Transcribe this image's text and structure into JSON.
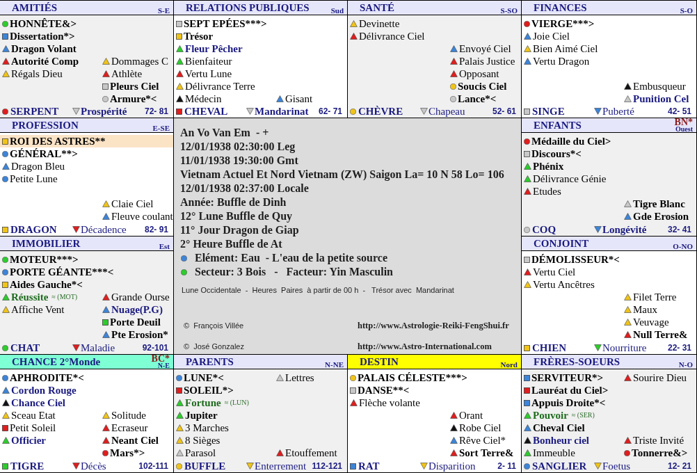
{
  "palaces": [
    {
      "header": {
        "title": "AMITIÉS",
        "direction": "S-E",
        "color": "#e6e6fa"
      },
      "shaded": true,
      "main_stars": [
        {
          "kind": "circle",
          "color": "#2ecc2e",
          "label": {
            "text": "HONNÊTE&>",
            "color": "#000000",
            "bold": true
          },
          "highlighted": false
        },
        {
          "kind": "square",
          "color": "#3d85d8",
          "label": {
            "text": "Dissertation*>",
            "color": "#000000",
            "bold": true
          },
          "highlighted": false
        },
        {
          "kind": "triangle",
          "color": "#3d85d8",
          "label": {
            "text": "Dragon Volant",
            "color": "#000000",
            "bold": true
          },
          "highlighted": false
        },
        {
          "kind": "triangle",
          "color": "#e01e1e",
          "label": {
            "text": "Autorité Comp",
            "color": "#000000",
            "bold": true
          },
          "highlighted": false
        },
        {
          "kind": "triangle",
          "color": "#f0c419",
          "label": {
            "text": "Régals Dieu",
            "color": "#000000",
            "bold": false
          },
          "highlighted": false
        }
      ],
      "side_stars_bottom": [
        {
          "kind": "triangle",
          "color": "#f0c419",
          "label": {
            "text": "Dommages C",
            "color": "#000000",
            "bold": false
          }
        },
        {
          "kind": "triangle",
          "color": "#e01e1e",
          "label": {
            "text": "Athlète",
            "color": "#000000",
            "bold": false
          }
        },
        {
          "kind": "square",
          "color": "#c8c8c8",
          "label": {
            "text": "Pleurs Ciel",
            "color": "#000000",
            "bold": true
          }
        },
        {
          "kind": "circle",
          "color": "#c8c8c8",
          "label": {
            "text": "Armure*<",
            "color": "#000000",
            "bold": true
          }
        }
      ],
      "footer": {
        "branch": {
          "name": "SERPENT",
          "kind": "circle",
          "color": "#e01e1e"
        },
        "phase": {
          "name": "Prospérité",
          "color": "#c8c8c8",
          "bold": true
        },
        "ages": "72- 81"
      }
    },
    {
      "header": {
        "title": "RELATIONS PUBLIQUES",
        "direction": "Sud",
        "color": "#e6e6fa"
      },
      "shaded": false,
      "main_stars": [
        {
          "kind": "square",
          "color": "#c8c8c8",
          "label": {
            "text": "SEPT EPÉES***>",
            "color": "#000000",
            "bold": true
          },
          "highlighted": false
        },
        {
          "kind": "square",
          "color": "#f0c419",
          "label": {
            "text": "Trésor",
            "color": "#000000",
            "bold": true
          },
          "highlighted": false
        },
        {
          "kind": "triangle",
          "color": "#2ecc2e",
          "label": {
            "text": "Fleur Pêcher",
            "color": "#1a1a80",
            "bold": true
          },
          "highlighted": false
        },
        {
          "kind": "triangle",
          "color": "#2ecc2e",
          "label": {
            "text": "Bienfaiteur",
            "color": "#000000",
            "bold": false
          },
          "highlighted": false
        },
        {
          "kind": "triangle",
          "color": "#e01e1e",
          "label": {
            "text": "Vertu Lune",
            "color": "#000000",
            "bold": false
          },
          "highlighted": false
        },
        {
          "kind": "triangle",
          "color": "#f0c419",
          "label": {
            "text": "Délivrance Terre",
            "color": "#000000",
            "bold": false
          },
          "highlighted": false
        },
        {
          "kind": "triangle",
          "color": "#111111",
          "label": {
            "text": "Médecin",
            "color": "#000000",
            "bold": false
          },
          "highlighted": false
        }
      ],
      "side_stars_bottom": [
        {
          "kind": "triangle",
          "color": "#3d85d8",
          "label": {
            "text": "Gisant",
            "color": "#000000",
            "bold": false
          }
        }
      ],
      "footer": {
        "branch": {
          "name": "CHEVAL",
          "kind": "square",
          "color": "#e01e1e"
        },
        "phase": {
          "name": "Mandarinat",
          "color": "#c8c8c8",
          "bold": true
        },
        "ages": "62- 71"
      }
    },
    {
      "header": {
        "title": "SANTÉ",
        "direction": "S-SO",
        "color": "#e6e6fa"
      },
      "shaded": true,
      "main_stars": [
        {
          "kind": "triangle",
          "color": "#f0c419",
          "label": {
            "text": "Devinette",
            "color": "#000000",
            "bold": false
          },
          "highlighted": false
        },
        {
          "kind": "triangle",
          "color": "#e01e1e",
          "label": {
            "text": "Délivrance Ciel",
            "color": "#000000",
            "bold": false
          },
          "highlighted": false
        }
      ],
      "side_stars_bottom": [
        {
          "kind": "triangle",
          "color": "#3d85d8",
          "label": {
            "text": "Envoyé Ciel",
            "color": "#000000",
            "bold": false
          }
        },
        {
          "kind": "triangle",
          "color": "#e01e1e",
          "label": {
            "text": "Palais Justice",
            "color": "#000000",
            "bold": false
          }
        },
        {
          "kind": "triangle",
          "color": "#e01e1e",
          "label": {
            "text": "Opposant",
            "color": "#000000",
            "bold": false
          }
        },
        {
          "kind": "circle",
          "color": "#f0c419",
          "label": {
            "text": "Soucis Ciel",
            "color": "#000000",
            "bold": true
          }
        },
        {
          "kind": "circle",
          "color": "#c8c8c8",
          "label": {
            "text": "Lance*<",
            "color": "#000000",
            "bold": true
          }
        }
      ],
      "footer": {
        "branch": {
          "name": "CHÈVRE",
          "kind": "circle",
          "color": "#f0c419"
        },
        "phase": {
          "name": "Chapeau",
          "color": "#c8c8c8",
          "bold": false
        },
        "ages": "52- 61"
      }
    },
    {
      "header": {
        "title": "FINANCES",
        "direction": "S-O",
        "color": "#e6e6fa"
      },
      "shaded": false,
      "main_stars": [
        {
          "kind": "circle",
          "color": "#e01e1e",
          "label": {
            "text": "VIERGE***>",
            "color": "#000000",
            "bold": true
          },
          "highlighted": false
        },
        {
          "kind": "triangle",
          "color": "#3d85d8",
          "label": {
            "text": "Joie Ciel",
            "color": "#000000",
            "bold": false
          },
          "highlighted": false
        },
        {
          "kind": "triangle",
          "color": "#f0c419",
          "label": {
            "text": "Bien Aimé Ciel",
            "color": "#000000",
            "bold": false
          },
          "highlighted": false
        },
        {
          "kind": "triangle",
          "color": "#3d85d8",
          "label": {
            "text": "Vertu Dragon",
            "color": "#000000",
            "bold": false
          },
          "highlighted": false
        }
      ],
      "side_stars_bottom": [
        {
          "kind": "triangle",
          "color": "#111111",
          "label": {
            "text": "Embusqueur",
            "color": "#000000",
            "bold": false
          }
        },
        {
          "kind": "triangle",
          "color": "#c8c8c8",
          "label": {
            "text": "Punition Cel",
            "color": "#1a1a80",
            "bold": true
          }
        }
      ],
      "footer": {
        "branch": {
          "name": "SINGE",
          "kind": "square",
          "color": "#c8c8c8"
        },
        "phase": {
          "name": "Puberté",
          "color": "#3d85d8",
          "bold": false
        },
        "ages": "42- 51"
      }
    },
    {
      "header": {
        "title": "PROFESSION",
        "direction": "E-SE",
        "color": "#e6e6fa"
      },
      "shaded": false,
      "main_stars": [
        {
          "kind": "square",
          "color": "#f0c419",
          "label": {
            "text": "ROI DES ASTRES**",
            "color": "#000000",
            "bold": true
          },
          "highlighted": true
        },
        {
          "kind": "circle",
          "color": "#3d85d8",
          "label": {
            "text": "GÉNÉRAL**>",
            "color": "#000000",
            "bold": true
          },
          "highlighted": false
        },
        {
          "kind": "triangle",
          "color": "#3d85d8",
          "label": {
            "text": "Dragon Bleu",
            "color": "#000000",
            "bold": false
          },
          "highlighted": false
        },
        {
          "kind": "circle",
          "color": "#3d85d8",
          "label": {
            "text": "Petite Lune",
            "color": "#000000",
            "bold": false
          },
          "highlighted": false
        }
      ],
      "side_stars_bottom": [
        {
          "kind": "triangle",
          "color": "#f0c419",
          "label": {
            "text": "Claie Ciel",
            "color": "#000000",
            "bold": false
          }
        },
        {
          "kind": "triangle",
          "color": "#3d85d8",
          "label": {
            "text": "Fleuve coulant",
            "color": "#000000",
            "bold": false
          }
        }
      ],
      "footer": {
        "branch": {
          "name": "DRAGON",
          "kind": "square",
          "color": "#f0c419"
        },
        "phase": {
          "name": "Décadence",
          "color": "#e01e1e",
          "bold": false
        },
        "ages": "82- 91"
      }
    },
    {
      "header": {
        "title": "ENFANTS",
        "direction": "Ouest",
        "marker": "BN*",
        "color": "#e6e6fa"
      },
      "shaded": true,
      "main_stars": [
        {
          "kind": "circle",
          "color": "#e01e1e",
          "label": {
            "text": "Médaille du Ciel>",
            "color": "#000000",
            "bold": true
          },
          "highlighted": false
        },
        {
          "kind": "square",
          "color": "#c8c8c8",
          "label": {
            "text": "Discours*<",
            "color": "#000000",
            "bold": true
          },
          "highlighted": false
        },
        {
          "kind": "triangle",
          "color": "#2ecc2e",
          "label": {
            "text": "Phénix",
            "color": "#000000",
            "bold": true
          },
          "highlighted": false
        },
        {
          "kind": "triangle",
          "color": "#2ecc2e",
          "label": {
            "text": "Délivrance Génie",
            "color": "#000000",
            "bold": false
          },
          "highlighted": false
        },
        {
          "kind": "triangle",
          "color": "#e01e1e",
          "label": {
            "text": "Etudes",
            "color": "#000000",
            "bold": false
          },
          "highlighted": false
        }
      ],
      "side_stars_bottom": [
        {
          "kind": "triangle",
          "color": "#c8c8c8",
          "label": {
            "text": "Tigre Blanc",
            "color": "#000000",
            "bold": true
          }
        },
        {
          "kind": "triangle",
          "color": "#3d85d8",
          "label": {
            "text": "Gde Erosion",
            "color": "#000000",
            "bold": true
          }
        }
      ],
      "footer": {
        "branch": {
          "name": "COQ",
          "kind": "circle",
          "color": "#c8c8c8"
        },
        "phase": {
          "name": "Longévité",
          "color": "#3d85d8",
          "bold": true
        },
        "ages": "32- 41"
      }
    },
    {
      "header": {
        "title": "IMMOBILIER",
        "direction": "Est",
        "color": "#e6e6fa"
      },
      "shaded": true,
      "main_stars": [
        {
          "kind": "circle",
          "color": "#2ecc2e",
          "label": {
            "text": "MOTEUR***>",
            "color": "#000000",
            "bold": true
          },
          "highlighted": false
        },
        {
          "kind": "circle",
          "color": "#3d85d8",
          "label": {
            "text": "PORTE GÉANTE***<",
            "color": "#000000",
            "bold": true
          },
          "highlighted": false
        },
        {
          "kind": "square",
          "color": "#f0c419",
          "label": {
            "text": "Aides Gauche*<",
            "color": "#000000",
            "bold": true
          },
          "highlighted": false
        },
        {
          "kind": "triangle",
          "color": "#2ecc2e",
          "label": {
            "text": "Réussite",
            "color": "#1e6b1e",
            "bold": true
          },
          "note": "≈ (MOT)",
          "highlighted": false
        },
        {
          "kind": "triangle",
          "color": "#f0c419",
          "label": {
            "text": "Affiche Vent",
            "color": "#000000",
            "bold": false
          },
          "highlighted": false
        }
      ],
      "side_stars_bottom": [
        {
          "kind": "triangle",
          "color": "#e01e1e",
          "label": {
            "text": "Grande Ourse",
            "color": "#000000",
            "bold": false
          }
        },
        {
          "kind": "triangle",
          "color": "#3d85d8",
          "label": {
            "text": "Nuage(P.G)",
            "color": "#1a1a80",
            "bold": true
          }
        },
        {
          "kind": "square",
          "color": "#2ecc2e",
          "label": {
            "text": "Porte Deuil",
            "color": "#000000",
            "bold": true
          }
        },
        {
          "kind": "triangle",
          "color": "#3d85d8",
          "label": {
            "text": "Pte Erosion*",
            "color": "#000000",
            "bold": true
          }
        }
      ],
      "footer": {
        "branch": {
          "name": "CHAT",
          "kind": "circle",
          "color": "#2ecc2e"
        },
        "phase": {
          "name": "Maladie",
          "color": "#e01e1e",
          "bold": false
        },
        "ages": "92-101"
      }
    },
    {
      "header": {
        "title": "CONJOINT",
        "direction": "O-NO",
        "color": "#e6e6fa"
      },
      "shaded": false,
      "main_stars": [
        {
          "kind": "square",
          "color": "#c8c8c8",
          "label": {
            "text": "DÉMOLISSEUR*<",
            "color": "#000000",
            "bold": true
          },
          "highlighted": false
        },
        {
          "kind": "triangle",
          "color": "#e01e1e",
          "label": {
            "text": "Vertu Ciel",
            "color": "#000000",
            "bold": false
          },
          "highlighted": false
        },
        {
          "kind": "triangle",
          "color": "#f0c419",
          "label": {
            "text": "Vertu Ancêtres",
            "color": "#000000",
            "bold": false
          },
          "highlighted": false
        }
      ],
      "side_stars_bottom": [
        {
          "kind": "triangle",
          "color": "#f0c419",
          "label": {
            "text": "Filet Terre",
            "color": "#000000",
            "bold": false
          }
        },
        {
          "kind": "triangle",
          "color": "#f0c419",
          "label": {
            "text": "Maux",
            "color": "#000000",
            "bold": false
          }
        },
        {
          "kind": "triangle",
          "color": "#f0c419",
          "label": {
            "text": "Veuvage",
            "color": "#000000",
            "bold": false
          }
        },
        {
          "kind": "triangle",
          "color": "#e01e1e",
          "label": {
            "text": "Null Terre&",
            "color": "#000000",
            "bold": true
          }
        }
      ],
      "footer": {
        "branch": {
          "name": "CHIEN",
          "kind": "square",
          "color": "#f0c419"
        },
        "phase": {
          "name": "Nourriture",
          "color": "#2ecc2e",
          "bold": false
        },
        "ages": "22- 31"
      }
    },
    {
      "header": {
        "title": "CHANCE 2°Monde",
        "direction": "N-E",
        "marker": "BC*",
        "color": "#7fffd4"
      },
      "shaded": false,
      "main_stars": [
        {
          "kind": "circle",
          "color": "#3d85d8",
          "label": {
            "text": "APHRODITE*<",
            "color": "#000000",
            "bold": true
          },
          "highlighted": false
        },
        {
          "kind": "triangle",
          "color": "#3d85d8",
          "label": {
            "text": "Cordon Rouge",
            "color": "#1a1a80",
            "bold": true
          },
          "highlighted": false
        },
        {
          "kind": "triangle",
          "color": "#111111",
          "label": {
            "text": "Chance Ciel",
            "color": "#1a1a80",
            "bold": true
          },
          "highlighted": false
        },
        {
          "kind": "triangle",
          "color": "#f0c419",
          "label": {
            "text": "Sceau Etat",
            "color": "#000000",
            "bold": false
          },
          "highlighted": false
        },
        {
          "kind": "square",
          "color": "#e01e1e",
          "label": {
            "text": "Petit Soleil",
            "color": "#000000",
            "bold": false
          },
          "highlighted": false
        },
        {
          "kind": "triangle",
          "color": "#2ecc2e",
          "label": {
            "text": "Officier",
            "color": "#1a1a80",
            "bold": true
          },
          "highlighted": false
        }
      ],
      "side_stars_bottom": [
        {
          "kind": "triangle",
          "color": "#f0c419",
          "label": {
            "text": "Solitude",
            "color": "#000000",
            "bold": false
          }
        },
        {
          "kind": "triangle",
          "color": "#e01e1e",
          "label": {
            "text": "Ecraseur",
            "color": "#000000",
            "bold": false
          }
        },
        {
          "kind": "triangle",
          "color": "#e01e1e",
          "label": {
            "text": "Neant Ciel",
            "color": "#000000",
            "bold": true
          }
        },
        {
          "kind": "circle",
          "color": "#e01e1e",
          "label": {
            "text": "Mars*>",
            "color": "#000000",
            "bold": true
          }
        }
      ],
      "footer": {
        "branch": {
          "name": "TIGRE",
          "kind": "square",
          "color": "#2ecc2e"
        },
        "phase": {
          "name": "Décès",
          "color": "#e01e1e",
          "bold": false
        },
        "ages": "102-111"
      }
    },
    {
      "header": {
        "title": "PARENTS",
        "direction": "N-NE",
        "color": "#e6e6fa"
      },
      "shaded": true,
      "main_stars": [
        {
          "kind": "circle",
          "color": "#3d85d8",
          "label": {
            "text": "LUNE*<",
            "color": "#000000",
            "bold": true
          },
          "highlighted": false
        },
        {
          "kind": "square",
          "color": "#e01e1e",
          "label": {
            "text": "SOLEIL*>",
            "color": "#000000",
            "bold": true
          },
          "highlighted": false
        },
        {
          "kind": "triangle",
          "color": "#2ecc2e",
          "label": {
            "text": "Fortune",
            "color": "#1e6b1e",
            "bold": true
          },
          "note": "≈ (LUN)",
          "highlighted": false
        },
        {
          "kind": "triangle",
          "color": "#2ecc2e",
          "label": {
            "text": "Jupiter",
            "color": "#000000",
            "bold": true
          },
          "highlighted": false
        },
        {
          "kind": "triangle",
          "color": "#f0c419",
          "label": {
            "text": "3 Marches",
            "color": "#000000",
            "bold": false
          },
          "highlighted": false
        },
        {
          "kind": "triangle",
          "color": "#f0c419",
          "label": {
            "text": "8 Sièges",
            "color": "#000000",
            "bold": false
          },
          "highlighted": false
        },
        {
          "kind": "triangle",
          "color": "#c8c8c8",
          "label": {
            "text": "Parasol",
            "color": "#000000",
            "bold": false
          },
          "highlighted": false
        }
      ],
      "side_stars_top": [
        {
          "kind": "triangle",
          "color": "#c8c8c8",
          "label": {
            "text": "Lettres",
            "color": "#000000",
            "bold": false
          }
        }
      ],
      "side_stars_bottom": [
        {
          "kind": "triangle",
          "color": "#e01e1e",
          "label": {
            "text": "Etouffement",
            "color": "#000000",
            "bold": false
          }
        }
      ],
      "footer": {
        "branch": {
          "name": "BUFFLE",
          "kind": "circle",
          "color": "#f0c419"
        },
        "phase": {
          "name": "Enterrement",
          "color": "#f0c419",
          "bold": false
        },
        "ages": "112-121"
      }
    },
    {
      "header": {
        "title": "DESTIN",
        "direction": "Nord",
        "color": "#ffff00"
      },
      "shaded": false,
      "main_stars": [
        {
          "kind": "circle",
          "color": "#f0c419",
          "label": {
            "text": "PALAIS CÉLESTE***>",
            "color": "#000000",
            "bold": true
          },
          "highlighted": false
        },
        {
          "kind": "square",
          "color": "#c8c8c8",
          "label": {
            "text": "DANSE**<",
            "color": "#000000",
            "bold": true
          },
          "highlighted": false
        },
        {
          "kind": "triangle",
          "color": "#e01e1e",
          "label": {
            "text": "Flèche volante",
            "color": "#000000",
            "bold": false
          },
          "highlighted": false
        }
      ],
      "side_stars_bottom": [
        {
          "kind": "triangle",
          "color": "#e01e1e",
          "label": {
            "text": "Orant",
            "color": "#000000",
            "bold": false
          }
        },
        {
          "kind": "triangle",
          "color": "#111111",
          "label": {
            "text": "Robe Ciel",
            "color": "#000000",
            "bold": false
          }
        },
        {
          "kind": "triangle",
          "color": "#3d85d8",
          "label": {
            "text": "Rêve Ciel*",
            "color": "#000000",
            "bold": false
          }
        },
        {
          "kind": "triangle",
          "color": "#e01e1e",
          "label": {
            "text": "Sort Terre&",
            "color": "#000000",
            "bold": true
          }
        }
      ],
      "footer": {
        "branch": {
          "name": "RAT",
          "kind": "square",
          "color": "#3d85d8"
        },
        "phase": {
          "name": "Disparition",
          "color": "#f0c419",
          "bold": false
        },
        "ages": "2- 11"
      }
    },
    {
      "header": {
        "title": "FRÈRES-SOEURS",
        "direction": "N-O",
        "color": "#e6e6fa"
      },
      "shaded": true,
      "main_stars": [
        {
          "kind": "square",
          "color": "#3d85d8",
          "label": {
            "text": "SERVITEUR*>",
            "color": "#000000",
            "bold": true
          },
          "highlighted": false
        },
        {
          "kind": "square",
          "color": "#e01e1e",
          "label": {
            "text": "Lauréat du Ciel>",
            "color": "#000000",
            "bold": true
          },
          "highlighted": false
        },
        {
          "kind": "square",
          "color": "#3d85d8",
          "label": {
            "text": "Appuis Droite*<",
            "color": "#000000",
            "bold": true
          },
          "highlighted": false
        },
        {
          "kind": "triangle",
          "color": "#2ecc2e",
          "label": {
            "text": "Pouvoir",
            "color": "#1e6b1e",
            "bold": true
          },
          "note": "≈ (SER)",
          "highlighted": false
        },
        {
          "kind": "triangle",
          "color": "#3d85d8",
          "label": {
            "text": "Cheval Ciel",
            "color": "#000000",
            "bold": true
          },
          "highlighted": false
        },
        {
          "kind": "triangle",
          "color": "#111111",
          "label": {
            "text": "Bonheur ciel",
            "color": "#1a1a80",
            "bold": true
          },
          "highlighted": false
        },
        {
          "kind": "triangle",
          "color": "#2ecc2e",
          "label": {
            "text": "Immeuble",
            "color": "#000000",
            "bold": false
          },
          "highlighted": false
        }
      ],
      "side_stars_top": [
        {
          "kind": "triangle",
          "color": "#e01e1e",
          "label": {
            "text": "Sourire Dieu",
            "color": "#000000",
            "bold": false
          }
        }
      ],
      "side_stars_bottom": [
        {
          "kind": "triangle",
          "color": "#e01e1e",
          "label": {
            "text": "Triste Invité",
            "color": "#000000",
            "bold": false
          }
        },
        {
          "kind": "circle",
          "color": "#e01e1e",
          "label": {
            "text": "Tonnerre&>",
            "color": "#000000",
            "bold": true
          }
        }
      ],
      "footer": {
        "branch": {
          "name": "SANGLIER",
          "kind": "circle",
          "color": "#3d85d8"
        },
        "phase": {
          "name": "Foetus",
          "color": "#f0c419",
          "bold": false
        },
        "ages": "12- 21"
      }
    }
  ],
  "center": {
    "lines": [
      "An Vo Van Em  - +",
      "12/01/1938 02:30:00 Leg",
      "11/01/1938 19:30:00 Gmt",
      "Vietnam Actuel Et Nord Vietnam (ZW) Saigon La= 10 N 58 Lo= 106",
      "12/01/1938 02:37:00 Locale",
      "Année: Buffle de Dinh",
      "12° Lune Buffle de Quy",
      "11° Jour Dragon de Giap",
      "2° Heure Buffle de At"
    ],
    "indicators": [
      {
        "text": "Elément: Eau  - L'eau de la petite source",
        "color": "#3d85d8"
      },
      {
        "text": "Secteur: 3 Bois   -   Facteur: Yin Masculin",
        "color": "#2ecc2e"
      }
    ],
    "note": "Lune Occidentale  -  Heures  Paires  à partir de 00 h  -   Trésor avec  Mandarinat",
    "credits": [
      {
        "author": "©  François Villée",
        "url": "http://www.Astrologie-Reiki-FengShui.fr"
      },
      {
        "author": "©  José Gonzalez",
        "url": "http://www.Astro-International.com"
      }
    ]
  }
}
